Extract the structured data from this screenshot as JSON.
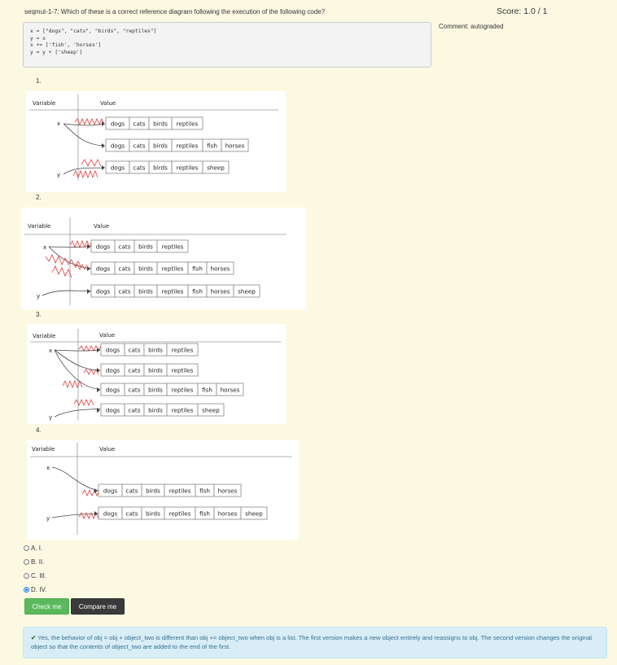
{
  "question": {
    "id": "seqmut-1-7",
    "prompt": "Which of these is a correct reference diagram following the execution of the following code?"
  },
  "score": "Score: 1.0 / 1",
  "comment": "Comment: autograded",
  "code_lines": [
    "x = [\"dogs\", \"cats\", \"birds\", \"reptiles\"]",
    "y = x",
    "x += ['fish', 'horses']",
    "y = y + ['sheep']"
  ],
  "diagram_headers": {
    "variable": "Variable",
    "value": "Value"
  },
  "diagrams": [
    {
      "number": "1.",
      "variables": [
        "x",
        "y"
      ],
      "lists": [
        [
          "dogs",
          "cats",
          "birds",
          "reptiles"
        ],
        [
          "dogs",
          "cats",
          "birds",
          "reptiles",
          "fish",
          "horses"
        ],
        [
          "dogs",
          "cats",
          "birds",
          "reptiles",
          "sheep"
        ]
      ]
    },
    {
      "number": "2.",
      "variables": [
        "x",
        "y"
      ],
      "lists": [
        [
          "dogs",
          "cats",
          "birds",
          "reptiles"
        ],
        [
          "dogs",
          "cats",
          "birds",
          "reptiles",
          "fish",
          "horses"
        ],
        [
          "dogs",
          "cats",
          "birds",
          "reptiles",
          "fish",
          "horses",
          "sheep"
        ]
      ]
    },
    {
      "number": "3.",
      "variables": [
        "x",
        "y"
      ],
      "lists": [
        [
          "dogs",
          "cats",
          "birds",
          "reptiles"
        ],
        [
          "dogs",
          "cats",
          "birds",
          "reptiles"
        ],
        [
          "dogs",
          "cats",
          "birds",
          "reptiles",
          "fish",
          "horses"
        ],
        [
          "dogs",
          "cats",
          "birds",
          "reptiles",
          "sheep"
        ]
      ]
    },
    {
      "number": "4.",
      "variables": [
        "x",
        "y"
      ],
      "lists": [
        [
          "dogs",
          "cats",
          "birds",
          "reptiles",
          "fish",
          "horses"
        ],
        [
          "dogs",
          "cats",
          "birds",
          "reptiles",
          "fish",
          "horses",
          "sheep"
        ]
      ]
    }
  ],
  "choices": [
    {
      "label": "A. I.",
      "selected": false
    },
    {
      "label": "B. II.",
      "selected": false
    },
    {
      "label": "C. III.",
      "selected": false
    },
    {
      "label": "D. IV.",
      "selected": true
    }
  ],
  "buttons": {
    "check": "Check me",
    "compare": "Compare me"
  },
  "feedback": "Yes, the behavior of obj = obj + object_two is different than obj += object_two when obj is a list. The first version makes a new object entirely and reassigns to obj. The second version changes the original object so that the contents of object_two are added to the end of the first.",
  "colors": {
    "accent": "#5cb85c",
    "strike": "#e03a3a",
    "selected": "#1a73e8"
  }
}
